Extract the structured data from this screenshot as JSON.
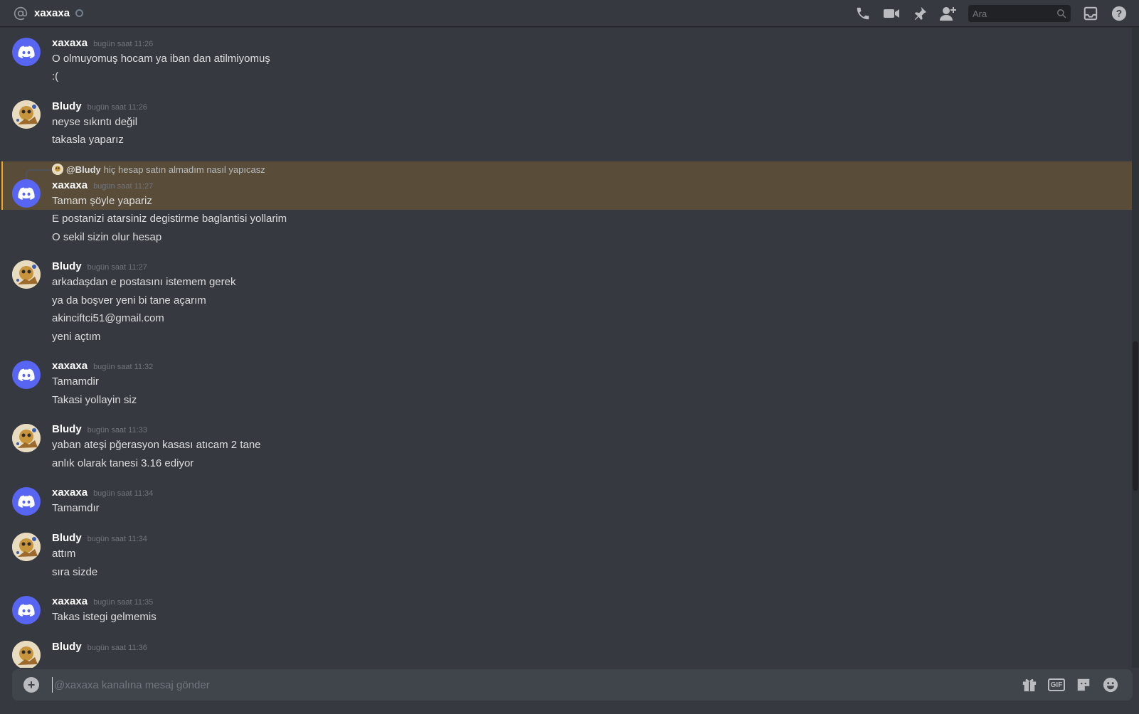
{
  "header": {
    "dm_name": "xaxaxa",
    "search_placeholder": "Ara",
    "icons": [
      "at-icon",
      "phone-call-icon",
      "video-call-icon",
      "pin-icon",
      "add-friend-icon",
      "search-icon",
      "inbox-icon",
      "help-icon"
    ]
  },
  "messages": [
    {
      "author": "xaxaxa",
      "timestamp": "bugün saat 11:26",
      "avatar": "discord",
      "lines": [
        "O olmuyomuş hocam ya iban dan atilmiyomuş",
        ":("
      ]
    },
    {
      "author": "Bludy",
      "timestamp": "bugün saat 11:26",
      "avatar": "bludy",
      "lines": [
        "neyse sıkıntı değil",
        "takasla yaparız"
      ]
    },
    {
      "author": "xaxaxa",
      "timestamp": "bugün saat 11:27",
      "avatar": "discord",
      "reply": {
        "mention": "@Bludy",
        "text": "hiç hesap satın almadım nasıl yapıcasz"
      },
      "lines": [
        "Tamam şöyle yapariz",
        "E postanizi atarsiniz degistirme baglantisi yollarim",
        "O sekil sizin olur hesap"
      ]
    },
    {
      "author": "Bludy",
      "timestamp": "bugün saat 11:27",
      "avatar": "bludy",
      "lines": [
        "arkadaşdan e postasını istemem gerek",
        "ya da boşver yeni bi tane açarım",
        "akinciftci51@gmail.com",
        "yeni açtım"
      ]
    },
    {
      "author": "xaxaxa",
      "timestamp": "bugün saat 11:32",
      "avatar": "discord",
      "lines": [
        "Tamamdir",
        "Takasi yollayin siz"
      ]
    },
    {
      "author": "Bludy",
      "timestamp": "bugün saat 11:33",
      "avatar": "bludy",
      "lines": [
        "yaban ateşi pğerasyon kasası atıcam 2 tane",
        "anlık olarak tanesi 3.16 ediyor"
      ]
    },
    {
      "author": "xaxaxa",
      "timestamp": "bugün saat 11:34",
      "avatar": "discord",
      "lines": [
        "Tamamdır"
      ]
    },
    {
      "author": "Bludy",
      "timestamp": "bugün saat 11:34",
      "avatar": "bludy",
      "lines": [
        "attım",
        "sıra sizde"
      ]
    },
    {
      "author": "xaxaxa",
      "timestamp": "bugün saat 11:35",
      "avatar": "discord",
      "lines": [
        "Takas istegi gelmemis"
      ]
    },
    {
      "author": "Bludy",
      "timestamp": "bugün saat 11:36",
      "avatar": "bludy",
      "lines": []
    }
  ],
  "composer": {
    "placeholder": "@xaxaxa kanalına mesaj gönder",
    "gif_label": "GIF",
    "icons": [
      "add-attachment-icon",
      "gift-icon",
      "gif-icon",
      "sticker-icon",
      "emoji-icon"
    ]
  },
  "colors": {
    "background": "#36393f",
    "accent": "#5865f2",
    "highlight": "#faa81a"
  }
}
